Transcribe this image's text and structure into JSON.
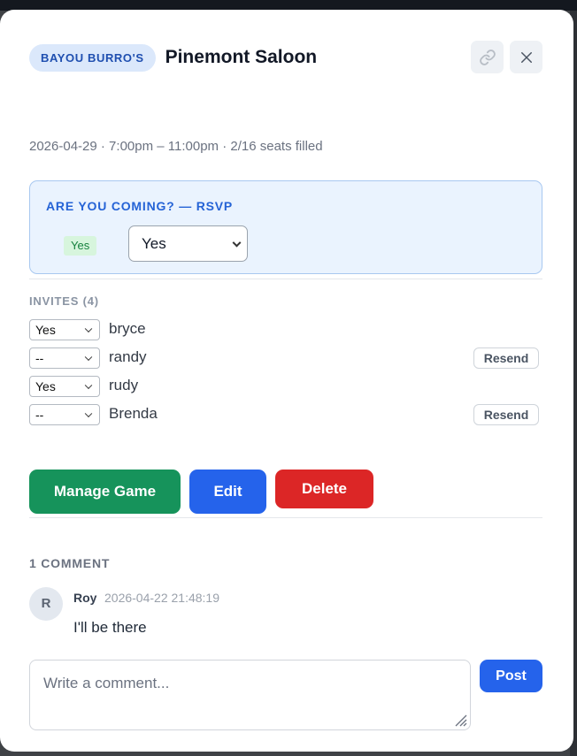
{
  "header": {
    "org_badge": "BAYOU BURRO'S",
    "title": "Pinemont Saloon",
    "link_icon": "link-icon",
    "close_icon": "close-icon"
  },
  "meta": "2026-04-29 · 7:00pm – 11:00pm · 2/16 seats filled",
  "rsvp": {
    "title": "ARE YOU COMING? — RSVP",
    "badge": "Yes",
    "selected": "Yes"
  },
  "invites": {
    "label": "INVITES (4)",
    "rows": [
      {
        "status": "Yes",
        "name": "bryce",
        "resend": ""
      },
      {
        "status": "--",
        "name": "randy",
        "resend": "Resend"
      },
      {
        "status": "Yes",
        "name": "rudy",
        "resend": ""
      },
      {
        "status": "--",
        "name": "Brenda",
        "resend": "Resend"
      }
    ]
  },
  "actions": {
    "manage": "Manage Game",
    "edit": "Edit",
    "delete": "Delete"
  },
  "comments": {
    "count_label": "1 COMMENT",
    "items": [
      {
        "initial": "R",
        "author": "Roy",
        "time": "2026-04-22 21:48:19",
        "text": "I'll be there"
      }
    ],
    "input_placeholder": "Write a comment...",
    "post_label": "Post"
  },
  "colors": {
    "manage": "#16935b",
    "edit": "#2563eb",
    "delete": "#dc2626",
    "accent": "#2563d6"
  }
}
